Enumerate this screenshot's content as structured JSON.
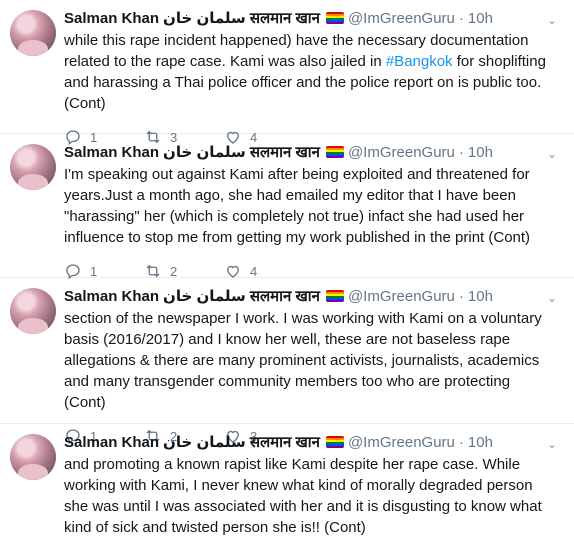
{
  "tweets": [
    {
      "author_name": "Salman Khan",
      "author_name_urdu": "سلمان خان",
      "author_name_hindi": "सलमान खान",
      "handle": "@ImGreenGuru",
      "time": "10h",
      "text_before": "while this rape incident happened) have the necessary documentation related to the rape case. Kami was also jailed in ",
      "hashtag": "#Bangkok",
      "text_after": " for shoplifting and harassing a Thai police officer and the police report on is public too. (Cont)",
      "replies": "1",
      "retweets": "3",
      "likes": "4"
    },
    {
      "author_name": "Salman Khan",
      "author_name_urdu": "سلمان خان",
      "author_name_hindi": "सलमान खान",
      "handle": "@ImGreenGuru",
      "time": "10h",
      "text_before": "I'm speaking out against Kami after being exploited and threatened for years.Just a month ago, she had emailed my editor that I have been \"harassing\" her (which is completely not true) infact she had used her influence to stop me from getting my work published in the print (Cont)",
      "hashtag": "",
      "text_after": "",
      "replies": "1",
      "retweets": "2",
      "likes": "4"
    },
    {
      "author_name": "Salman Khan",
      "author_name_urdu": "سلمان خان",
      "author_name_hindi": "सलमान खान",
      "handle": "@ImGreenGuru",
      "time": "10h",
      "text_before": "section of the newspaper I work. I was working with Kami on a voluntary basis (2016/2017) and I know her well, these are not baseless rape allegations & there are many prominent activists, journalists, academics and many transgender community members too who are protecting (Cont)",
      "hashtag": "",
      "text_after": "",
      "replies": "1",
      "retweets": "2",
      "likes": "3"
    },
    {
      "author_name": "Salman Khan",
      "author_name_urdu": "سلمان خان",
      "author_name_hindi": "सलमान खान",
      "handle": "@ImGreenGuru",
      "time": "10h",
      "text_before": "and promoting a known rapist like Kami despite her rape case. While working with Kami, I never knew what kind of morally degraded person she was until I was associated with her and it is disgusting to know what kind of sick and twisted person she is!! (Cont)",
      "hashtag": "",
      "text_after": "",
      "replies": "",
      "retweets": "",
      "likes": ""
    }
  ],
  "colors": {
    "link": "#1b95e0",
    "muted": "#657786",
    "divider": "#e6ecf0"
  },
  "icons": [
    "reply-icon",
    "retweet-icon",
    "like-icon",
    "chevron-down-icon",
    "rainbow-flag-icon"
  ]
}
